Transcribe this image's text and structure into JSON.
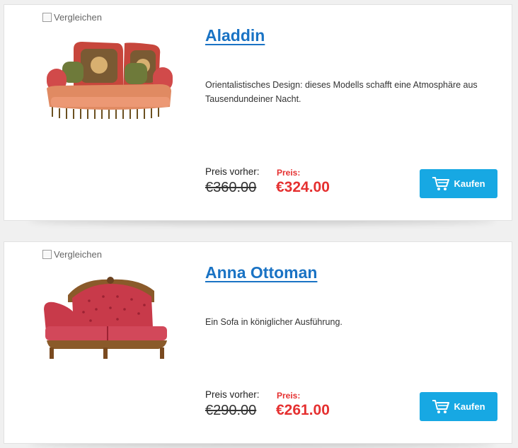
{
  "products": [
    {
      "compare_label": "Vergleichen",
      "title": "Aladdin",
      "description": "Orientalistisches Design: dieses Modells schafft eine Atmosphäre aus Tausendundeiner Nacht.",
      "previous_label": "Preis vorher:",
      "previous_price": "€360.00",
      "price_label": "Preis:",
      "price": "€324.00",
      "buy_label": "Kaufen"
    },
    {
      "compare_label": "Vergleichen",
      "title": "Anna Ottoman",
      "description": "Ein Sofa in königlicher Ausführung.",
      "previous_label": "Preis vorher:",
      "previous_price": "€290.00",
      "price_label": "Preis:",
      "price": "€261.00",
      "buy_label": "Kaufen"
    }
  ],
  "icons": {
    "buy": "shopping-cart-icon"
  },
  "colors": {
    "link": "#1a73c4",
    "sale": "#e53030",
    "button": "#17a8e3"
  }
}
